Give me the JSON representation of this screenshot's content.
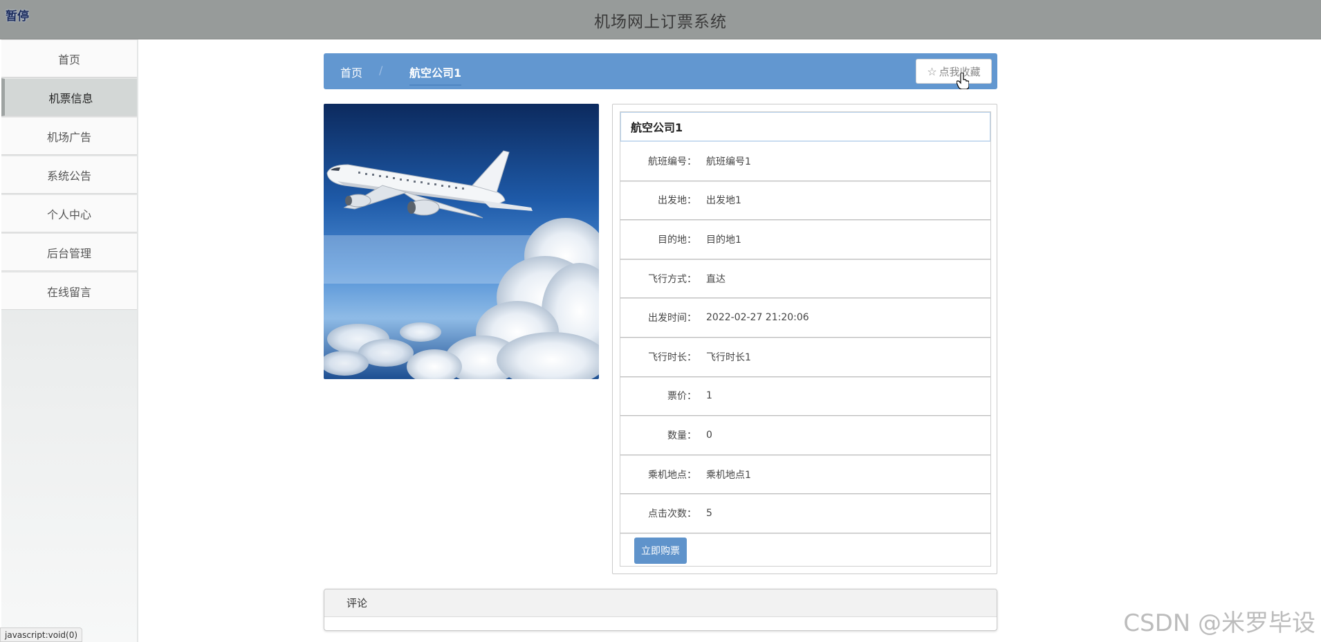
{
  "header": {
    "title": "机场网上订票系统",
    "pause_label": "暂停"
  },
  "sidebar": {
    "items": [
      {
        "label": "首页"
      },
      {
        "label": "机票信息",
        "active": true
      },
      {
        "label": "机场广告"
      },
      {
        "label": "系统公告"
      },
      {
        "label": "个人中心"
      },
      {
        "label": "后台管理"
      },
      {
        "label": "在线留言"
      }
    ]
  },
  "breadcrumb": {
    "home": "首页",
    "separator": "/",
    "current": "航空公司1"
  },
  "favorite": {
    "label": "点我收藏",
    "icon": "star-outline-icon"
  },
  "detail": {
    "title": "航空公司1",
    "fields": [
      {
        "label": "航班编号：",
        "value": "航班编号1"
      },
      {
        "label": "出发地：",
        "value": "出发地1"
      },
      {
        "label": "目的地：",
        "value": "目的地1"
      },
      {
        "label": "飞行方式：",
        "value": "直达"
      },
      {
        "label": "出发时间：",
        "value": "2022-02-27 21:20:06"
      },
      {
        "label": "飞行时长：",
        "value": "飞行时长1"
      },
      {
        "label": "票价：",
        "value": "1"
      },
      {
        "label": "数量：",
        "value": "0"
      },
      {
        "label": "乘机地点：",
        "value": "乘机地点1"
      },
      {
        "label": "点击次数：",
        "value": "5"
      }
    ],
    "buy_label": "立即购票"
  },
  "comments": {
    "title": "评论"
  },
  "statusbar": {
    "text": "javascript:void(0)"
  },
  "watermark": {
    "text": "CSDN @米罗毕设"
  },
  "colors": {
    "accent": "#6297d0",
    "topbar": "#979b9a"
  }
}
